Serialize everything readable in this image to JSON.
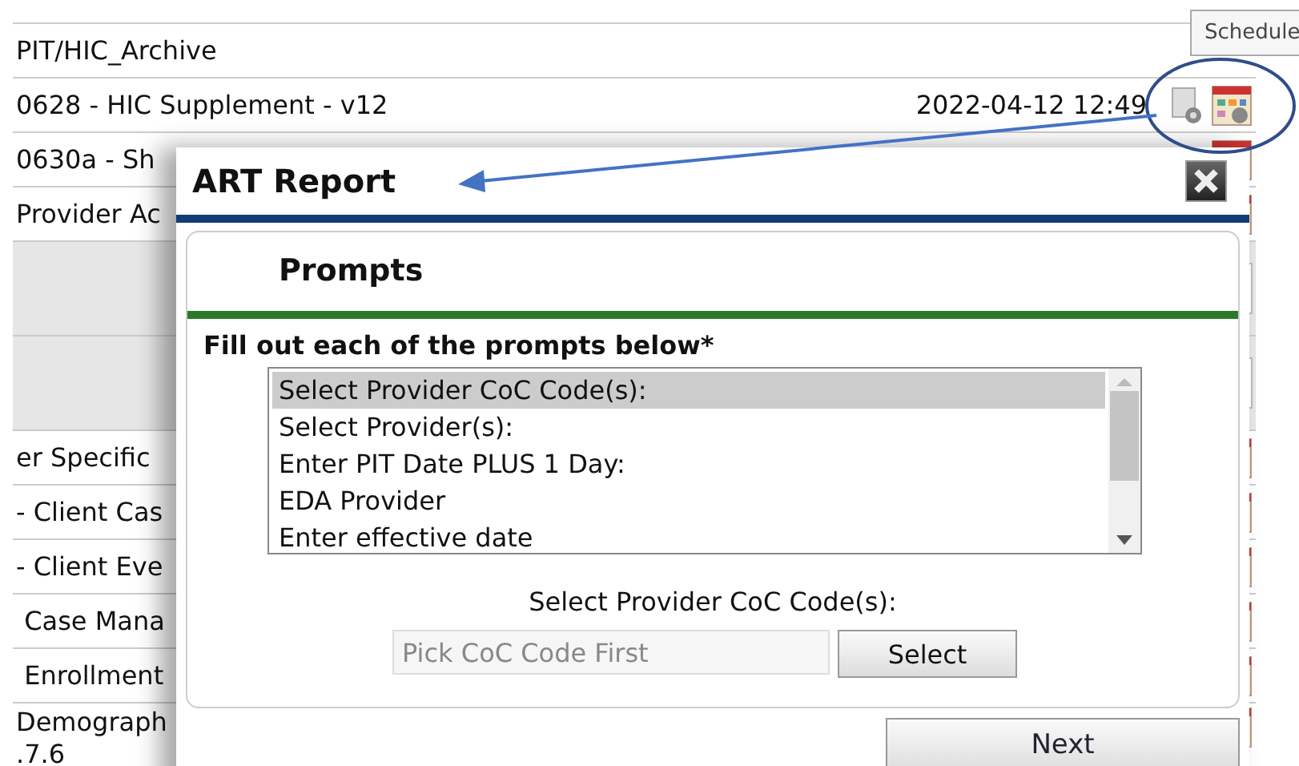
{
  "tooltip": "Schedule",
  "rows": [
    {
      "kind": "folder",
      "name": "PIT/HIC_Archive"
    },
    {
      "kind": "report",
      "name": "0628 - HIC Supplement - v12",
      "date": "2022-04-12 12:49"
    },
    {
      "kind": "report",
      "name": "0630a - Sh"
    },
    {
      "kind": "report",
      "name": "Provider Ac"
    },
    {
      "kind": "group"
    },
    {
      "kind": "group"
    },
    {
      "kind": "report",
      "name": "er Specific"
    },
    {
      "kind": "report",
      "name": "- Client Cas"
    },
    {
      "kind": "report",
      "name": "- Client Eve"
    },
    {
      "kind": "report",
      "name": " Case Mana"
    },
    {
      "kind": "report",
      "name": " Enrollment"
    },
    {
      "kind": "report",
      "name": "Demograph\n.7.6"
    }
  ],
  "dialog": {
    "title": "ART Report",
    "section": "Prompts",
    "instruction": "Fill out each of the prompts below",
    "required_mark": "*",
    "prompts": [
      {
        "label": "Select Provider CoC Code(s):",
        "selected": true
      },
      {
        "label": "Select Provider(s):",
        "selected": false
      },
      {
        "label": "Enter PIT Date PLUS 1 Day:",
        "selected": false
      },
      {
        "label": "EDA Provider",
        "selected": false
      },
      {
        "label": "Enter effective date",
        "selected": false
      }
    ],
    "field_label": "Select Provider CoC Code(s):",
    "field": {
      "placeholder": "Pick CoC Code First"
    },
    "select_button": "Select",
    "next_button": "Next"
  }
}
